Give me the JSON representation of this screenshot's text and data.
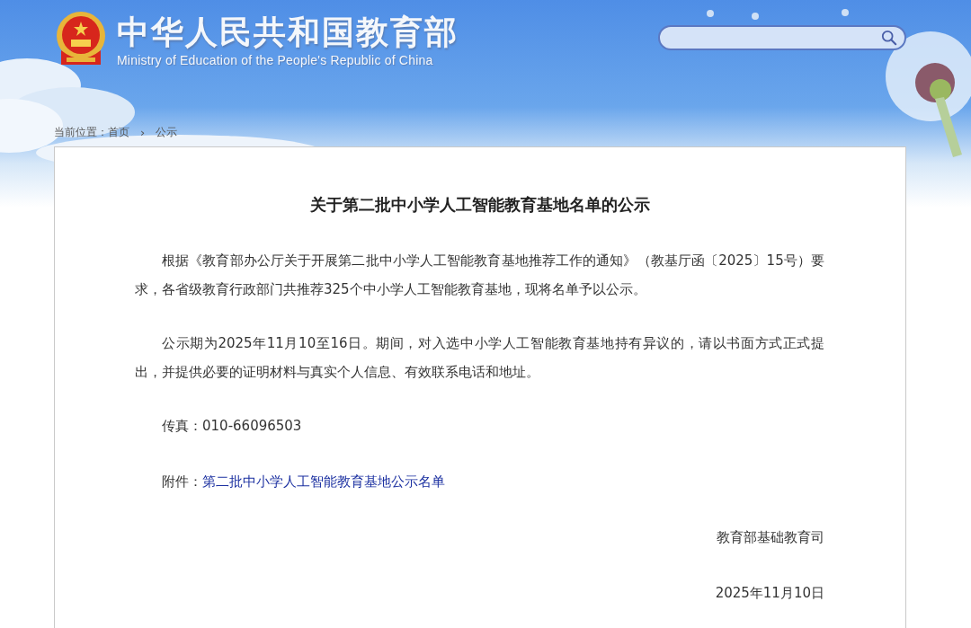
{
  "header": {
    "title": "中华人民共和国教育部",
    "subtitle": "Ministry of Education of the People's Republic of China"
  },
  "breadcrumb": {
    "label": "当前位置：",
    "separator": "›",
    "items": [
      {
        "text": "首页"
      },
      {
        "text": "公示"
      }
    ]
  },
  "article": {
    "title": "关于第二批中小学人工智能教育基地名单的公示",
    "paragraphs": [
      "根据《教育部办公厅关于开展第二批中小学人工智能教育基地推荐工作的通知》（教基厅函〔2025〕15号）要求，各省级教育行政部门共推荐325个中小学人工智能教育基地，现将名单予以公示。",
      "公示期为2025年11月10至16日。期间，对入选中小学人工智能教育基地持有异议的，请以书面方式正式提出，并提供必要的证明材料与真实个人信息、有效联系电话和地址。"
    ],
    "fax": {
      "label": "传真：",
      "value": "010-66096503"
    },
    "attachment": {
      "label": "附件：",
      "link": "第二批中小学人工智能教育基地公示名单"
    },
    "signature": "教育部基础教育司",
    "date": "2025年11月10日"
  }
}
